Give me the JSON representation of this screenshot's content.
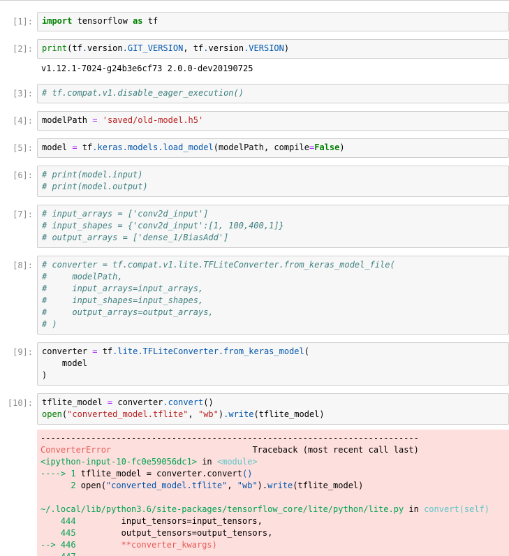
{
  "cells": [
    {
      "prompt": "[1]:",
      "code": [
        "import tensorflow as tf"
      ]
    },
    {
      "prompt": "[2]:",
      "code": [
        "print(tf.version.GIT_VERSION, tf.version.VERSION)"
      ],
      "output": "v1.12.1-7024-g24b3e6cf73 2.0.0-dev20190725"
    },
    {
      "prompt": "[3]:",
      "code": [
        "# tf.compat.v1.disable_eager_execution()"
      ]
    },
    {
      "prompt": "[4]:",
      "code": [
        "modelPath = 'saved/old-model.h5'"
      ]
    },
    {
      "prompt": "[5]:",
      "code": [
        "model = tf.keras.models.load_model(modelPath, compile=False)"
      ]
    },
    {
      "prompt": "[6]:",
      "code": [
        "# print(model.input)",
        "# print(model.output)"
      ]
    },
    {
      "prompt": "[7]:",
      "code": [
        "# input_arrays = ['conv2d_input']",
        "# input_shapes = {'conv2d_input':[1, 100,400,1]}",
        "# output_arrays = ['dense_1/BiasAdd']"
      ]
    },
    {
      "prompt": "[8]:",
      "code": [
        "# converter = tf.compat.v1.lite.TFLiteConverter.from_keras_model_file(",
        "#     modelPath,",
        "#     input_arrays=input_arrays,",
        "#     input_shapes=input_shapes,",
        "#     output_arrays=output_arrays,",
        "# )"
      ]
    },
    {
      "prompt": "[9]:",
      "code": [
        "converter = tf.lite.TFLiteConverter.from_keras_model(",
        "    model",
        ")"
      ]
    },
    {
      "prompt": "[10]:",
      "code": [
        "tflite_model = converter.convert()",
        "open(\"converted_model.tflite\", \"wb\").write(tflite_model)"
      ]
    }
  ],
  "error": {
    "dashes": "---------------------------------------------------------------------------",
    "name": "ConverterError",
    "traceback": "Traceback (most recent call last)",
    "input_ref": "<ipython-input-10-fc0e59056dc1>",
    "in_word": " in ",
    "module": "<module>",
    "arrow1": "----> 1 ",
    "line1_code": "tflite_model = converter.convert()",
    "line2_num": "      2 ",
    "line2_code": "open(\"converted_model.tflite\", \"wb\").write(tflite_model)",
    "file_path": "~/.local/lib/python3.6/site-packages/tensorflow_core/lite/python/lite.py",
    "file_func": "convert(self)",
    "ln444": "    444 ",
    "code444": "        input_tensors=input_tensors,",
    "ln445": "    445 ",
    "code445": "        output_tensors=output_tensors,",
    "arrow446": "--> 446 ",
    "code446": "        **converter_kwargs)",
    "ln447": "    447"
  }
}
